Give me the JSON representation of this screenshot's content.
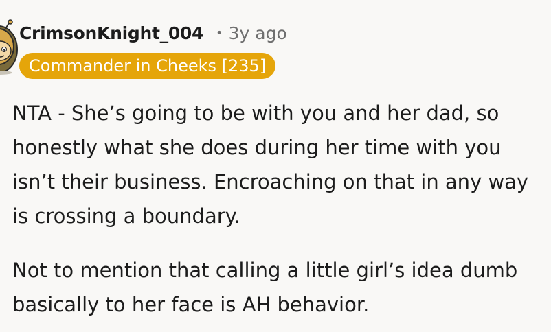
{
  "comment": {
    "username": "CrimsonKnight_004",
    "separator": "•",
    "timestamp": "3y ago",
    "flair": "Commander in Cheeks [235]",
    "flair_color": "#e5a50a",
    "avatar_icon": "snoo-avatar-icon",
    "paragraphs": [
      "NTA - She’s going to be with you and her dad, so\nhonestly what she does during her time with you\nisn’t their business. Encroaching on that in any way\nis crossing a boundary.",
      "Not to mention that calling a little girl’s idea dumb\nbasically to her face is AH behavior."
    ]
  }
}
